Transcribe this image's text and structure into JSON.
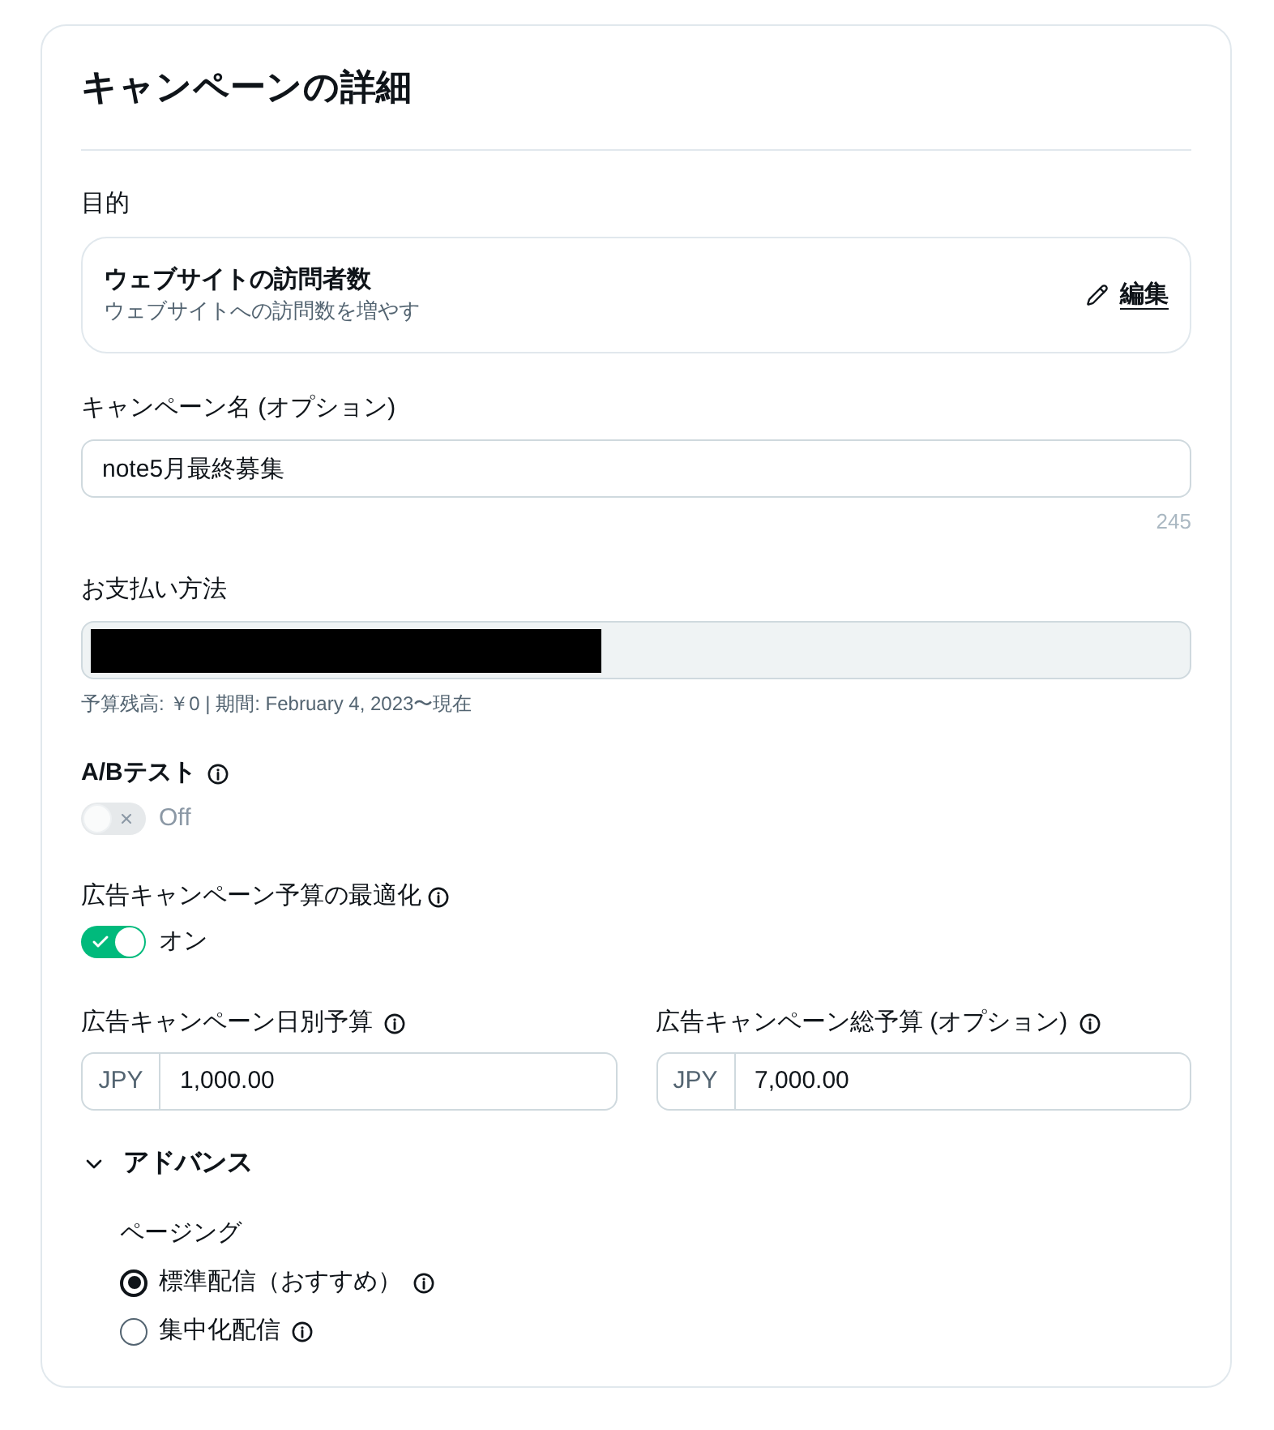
{
  "card": {
    "title": "キャンペーンの詳細"
  },
  "objective": {
    "label": "目的",
    "title": "ウェブサイトの訪問者数",
    "description": "ウェブサイトへの訪問数を増やす",
    "edit_label": "編集"
  },
  "campaign_name": {
    "label": "キャンペーン名 (オプション)",
    "value": "note5月最終募集",
    "remaining": "245"
  },
  "payment": {
    "label": "お支払い方法",
    "note": "予算残高: ￥0 | 期間: February 4, 2023〜現在"
  },
  "ab_test": {
    "label": "A/Bテスト",
    "state_label": "Off",
    "on": false,
    "disabled": true
  },
  "budget_optimization": {
    "label": "広告キャンペーン予算の最適化",
    "state_label": "オン",
    "on": true,
    "disabled": false
  },
  "budgets": [
    {
      "label": "広告キャンペーン日別予算",
      "currency": "JPY",
      "value": "1,000.00"
    },
    {
      "label": "広告キャンペーン総予算 (オプション)",
      "currency": "JPY",
      "value": "7,000.00"
    }
  ],
  "advanced": {
    "label": "アドバンス",
    "expanded": true,
    "pacing": {
      "label": "ページング",
      "options": [
        {
          "label": "標準配信（おすすめ）",
          "selected": true
        },
        {
          "label": "集中化配信",
          "selected": false
        }
      ]
    }
  }
}
